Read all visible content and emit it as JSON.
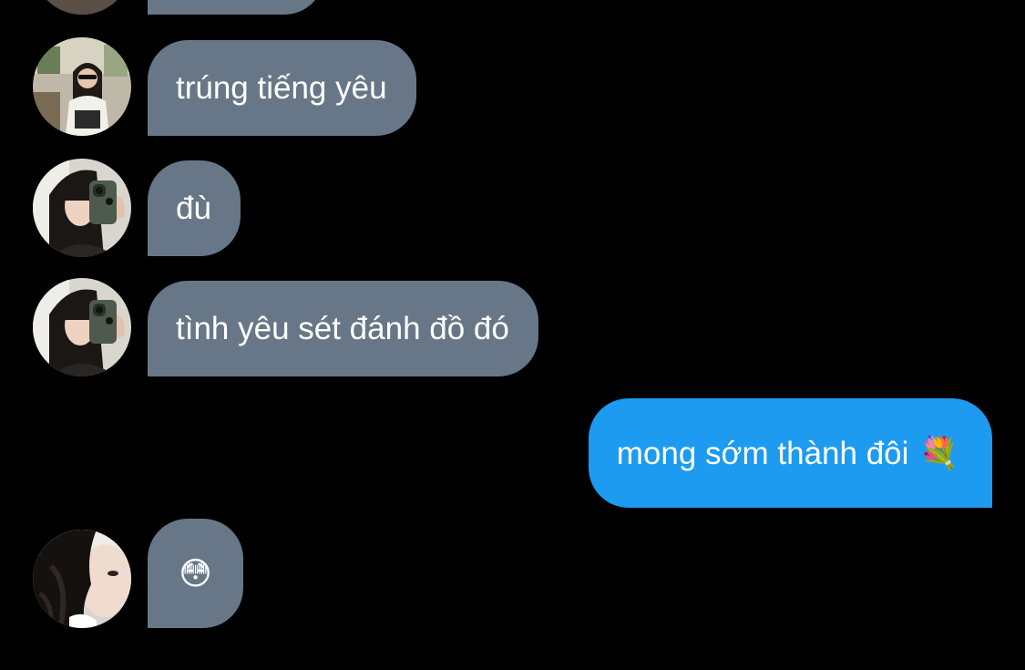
{
  "colors": {
    "background": "#000000",
    "incoming_bubble": "#677787",
    "outgoing_bubble": "#1d9bf0",
    "text": "#ffffff"
  },
  "messages": [
    {
      "direction": "incoming",
      "sender_avatar": "avatar-a",
      "text": ""
    },
    {
      "direction": "incoming",
      "sender_avatar": "avatar-b",
      "text": "trúng tiếng yêu"
    },
    {
      "direction": "incoming",
      "sender_avatar": "avatar-c",
      "text": "đù"
    },
    {
      "direction": "incoming",
      "sender_avatar": "avatar-c",
      "text": "tình yêu sét đánh đồ đó"
    },
    {
      "direction": "outgoing",
      "text": "mong sớm thành đôi",
      "emoji": "💐"
    },
    {
      "direction": "incoming",
      "sender_avatar": "avatar-d",
      "emoji": "😳"
    }
  ]
}
